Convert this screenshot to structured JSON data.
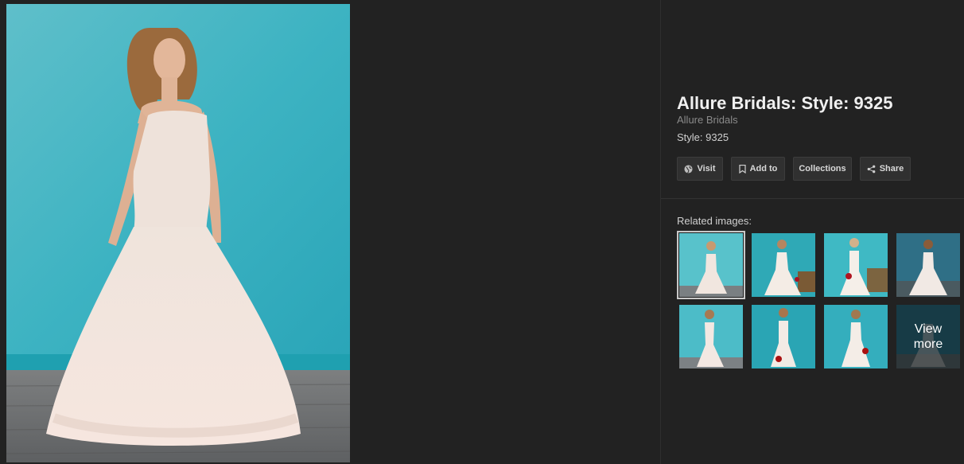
{
  "image_result": {
    "title": "Allure Bridals: Style: 9325",
    "source": "Allure Bridals",
    "description": "Style: 9325"
  },
  "actions": {
    "visit_label": "Visit",
    "add_to_label": "Add to",
    "collections_label": "Collections",
    "share_label": "Share"
  },
  "icons": {
    "visit": "globe-icon",
    "add_to": "bookmark-icon",
    "share": "share-icon"
  },
  "related": {
    "label": "Related images:",
    "view_more_line1": "View",
    "view_more_line2": "more",
    "thumbnail_count": 8
  },
  "colors": {
    "background": "#222222",
    "button_bg": "#303030",
    "backdrop_teal": "#3fb3c2",
    "gown": "#f3e3dc"
  }
}
